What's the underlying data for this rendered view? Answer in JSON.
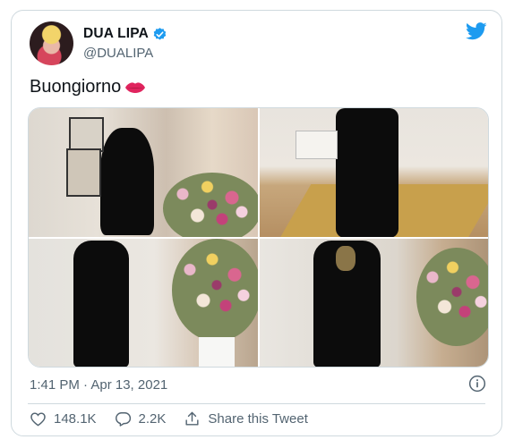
{
  "author": {
    "name": "DUA LIPA",
    "handle": "@DUALIPA"
  },
  "tweet": {
    "text": "Buongiorno",
    "emoji_icon": "lips-kiss-icon",
    "timestamp": "1:41 PM · Apr 13, 2021"
  },
  "actions": {
    "likes": "148.1K",
    "replies": "2.2K",
    "share_label": "Share this Tweet"
  },
  "colors": {
    "brand": "#1d9bf0",
    "muted": "#536471",
    "border": "#cfd9de"
  }
}
